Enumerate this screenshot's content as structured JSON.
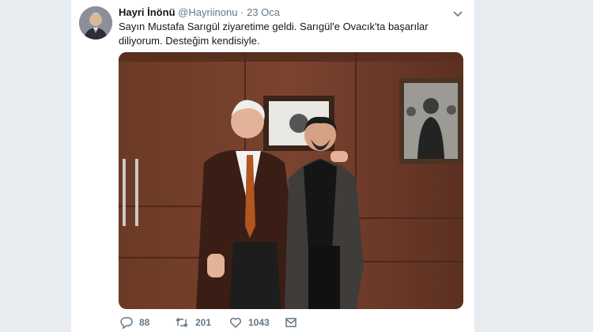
{
  "tweet": {
    "author_name": "Hayri İnönü",
    "handle": "@Hayriinonu",
    "separator": "·",
    "date": "23 Oca",
    "text": "Sayın Mustafa Sarıgül ziyaretime geldi. Sarıgül'e Ovacık'ta başarılar diliyorum. Desteğim kendisiyle."
  },
  "actions": {
    "reply_count": "88",
    "retweet_count": "201",
    "like_count": "1043"
  },
  "icons": [
    "avatar",
    "chevron-down-icon",
    "reply-icon",
    "retweet-icon",
    "like-icon",
    "message-icon"
  ],
  "colors": {
    "background": "#e6ecf0",
    "text": "#14171a",
    "muted": "#657786"
  }
}
